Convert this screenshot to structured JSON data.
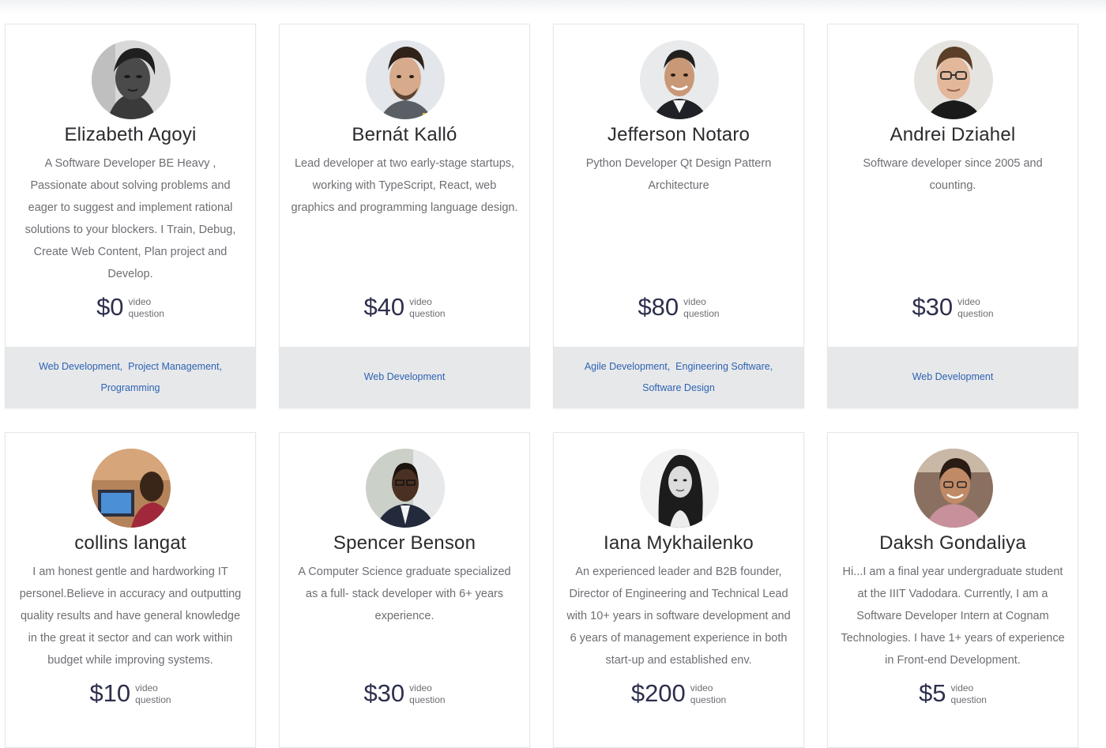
{
  "cards": [
    {
      "name": "Elizabeth Agoyi",
      "bio": "A Software Developer BE Heavy , Passionate about solving problems and eager to suggest and implement rational solutions to your blockers. I Train, Debug, Create Web Content, Plan project and Develop.",
      "price": "$0",
      "unit_1": "video",
      "unit_2": "question",
      "tags": [
        "Web Development,",
        "Project Management,",
        "Programming"
      ]
    },
    {
      "name": "Bernát Kalló",
      "bio": "Lead developer at two early-stage startups, working with TypeScript, React, web graphics and programming language design.",
      "price": "$40",
      "unit_1": "video",
      "unit_2": "question",
      "tags": [
        "Web Development"
      ]
    },
    {
      "name": "Jefferson Notaro",
      "bio": "Python Developer Qt Design Pattern Architecture",
      "price": "$80",
      "unit_1": "video",
      "unit_2": "question",
      "tags": [
        "Agile Development,",
        "Engineering Software,",
        "Software Design"
      ]
    },
    {
      "name": "Andrei Dziahel",
      "bio": "Software developer since 2005 and counting.",
      "price": "$30",
      "unit_1": "video",
      "unit_2": "question",
      "tags": [
        "Web Development"
      ]
    },
    {
      "name": "collins langat",
      "bio": "I am honest gentle and hardworking IT personel.Believe in accuracy and outputting quality results and have general knowledge in the great it sector and can work within budget while improving systems.",
      "price": "$10",
      "unit_1": "video",
      "unit_2": "question",
      "tags": []
    },
    {
      "name": "Spencer Benson",
      "bio": "A Computer Science graduate specialized as a full- stack developer with 6+ years experience.",
      "price": "$30",
      "unit_1": "video",
      "unit_2": "question",
      "tags": []
    },
    {
      "name": "Iana Mykhailenko",
      "bio": "An experienced leader and B2B founder, Director of Engineering and Technical Lead with 10+ years in software development and 6 years of management experience in both start-up and established env.",
      "price": "$200",
      "unit_1": "video",
      "unit_2": "question",
      "tags": []
    },
    {
      "name": "Daksh Gondaliya",
      "bio": "Hi...I am a final year undergraduate student at the IIIT Vadodara. Currently, I am a Software Developer Intern at Cognam Technologies. I have 1+ years of experience in Front-end Development.",
      "price": "$5",
      "unit_1": "video",
      "unit_2": "question",
      "tags": []
    }
  ]
}
